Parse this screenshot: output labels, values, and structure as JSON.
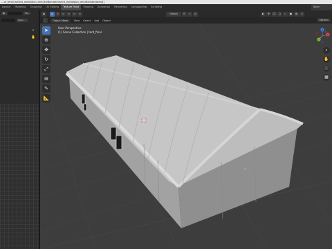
{
  "title_bar": {
    "text": "…ia_tent/Camera_exhibition_tent/3d/Blender/event_exhibition_tent/Blender/blend]"
  },
  "workspace_tabs": [
    {
      "label": "Layout",
      "active": false
    },
    {
      "label": "Modeling",
      "active": false
    },
    {
      "label": "Sculpting",
      "active": false
    },
    {
      "label": "UV Editing",
      "active": false
    },
    {
      "label": "Texture Paint",
      "active": true
    },
    {
      "label": "Shading",
      "active": false
    },
    {
      "label": "Animation",
      "active": false
    },
    {
      "label": "Rendering",
      "active": false
    },
    {
      "label": "Compositing",
      "active": false
    },
    {
      "label": "Scripting",
      "active": false
    }
  ],
  "scene": {
    "label": "Scen"
  },
  "left_panel": {
    "view_button": "File",
    "open_button": "Open"
  },
  "viewport_header": {
    "orientation": "Global",
    "options_label": "Options"
  },
  "viewport_subheader": {
    "mode": "Object Mode",
    "menus": [
      "View",
      "Select",
      "Add",
      "Object"
    ]
  },
  "viewport_info": {
    "line1": "User Perspective",
    "line2": "(1) Scene Collection | tent_final"
  },
  "gizmo": {
    "x_label": "X",
    "y_label": "Y",
    "z_label": "Z"
  },
  "colors": {
    "accent": "#4772b3",
    "viewport_bg": "#3d3d3d",
    "gizmo_x": "#e0475c",
    "gizmo_y": "#7cbf2f",
    "gizmo_z": "#3f7fe6"
  }
}
